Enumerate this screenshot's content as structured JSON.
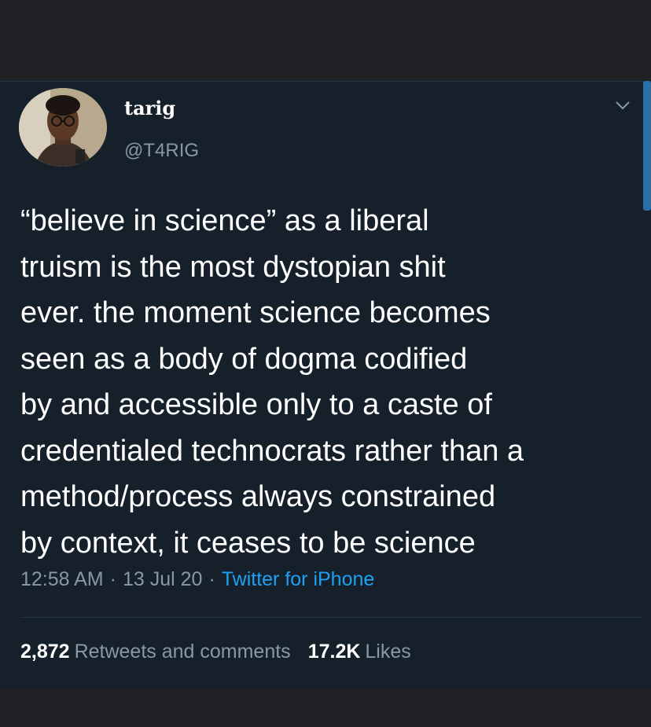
{
  "user": {
    "display_name": "tarig",
    "handle": "@T4RIG",
    "avatar_icon": "profile-photo"
  },
  "menu_icon": "chevron-down-icon",
  "tweet": {
    "text": "“believe in science” as a liberal\ntruism is the most dystopian shit\never. the moment science becomes\nseen as a body of dogma codified\nby and accessible only to a caste of\ncredentialed technocrats rather than a\nmethod/process always constrained\nby context, it ceases to be science",
    "time": "12:58 AM",
    "date": "13 Jul 20",
    "separator": "·",
    "source": "Twitter for iPhone"
  },
  "stats": {
    "retweets_count": "2,872",
    "retweets_label": "Retweets and comments",
    "likes_count": "17.2K",
    "likes_label": "Likes"
  },
  "colors": {
    "background": "#15202b",
    "text": "#ffffff",
    "secondary": "#8899a6",
    "accent": "#1da1f2"
  }
}
